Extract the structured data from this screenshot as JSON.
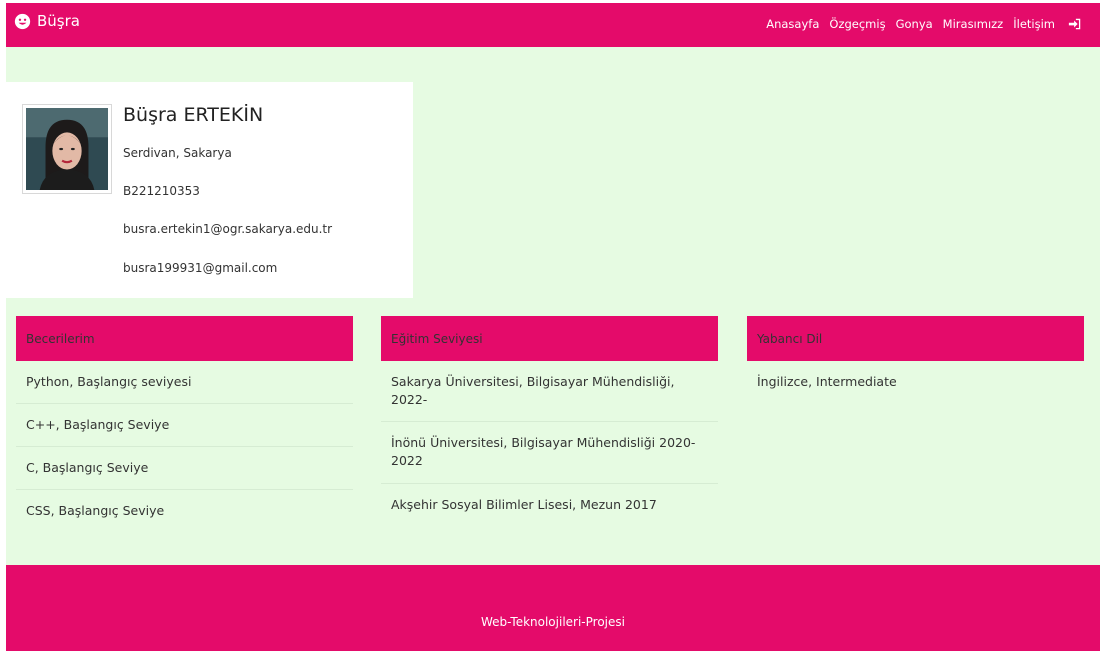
{
  "brand": {
    "name": "Büşra",
    "icon": "smile-icon"
  },
  "nav": {
    "items": [
      "Anasayfa",
      "Özgeçmiş",
      "Gonya",
      "Mirasımızz",
      "İletişim"
    ],
    "login_icon": "sign-in-icon"
  },
  "profile": {
    "name": "Büşra ERTEKİN",
    "location": "Serdivan, Sakarya",
    "student_id": "B221210353",
    "school_email": "busra.ertekin1@ogr.sakarya.edu.tr",
    "personal_email": "busra199931@gmail.com"
  },
  "skills": {
    "title": "Becerilerim",
    "items": [
      "Python, Başlangıç seviyesi",
      "C++, Başlangıç Seviye",
      "C, Başlangıç Seviye",
      "CSS, Başlangıç Seviye"
    ]
  },
  "education": {
    "title": "Eğitim Seviyesi",
    "items": [
      "Sakarya Üniversitesi, Bilgisayar Mühendisliği, 2022-",
      "İnönü Üniversitesi, Bilgisayar Mühendisliği 2020-2022",
      "Akşehir Sosyal Bilimler Lisesi, Mezun 2017"
    ]
  },
  "languages": {
    "title": "Yabancı Dil",
    "items": [
      "İngilizce, Intermediate"
    ]
  },
  "footer": {
    "text": "Web-Teknolojileri-Projesi"
  },
  "colors": {
    "accent": "#e40b6a",
    "background": "#e6fbe2"
  }
}
